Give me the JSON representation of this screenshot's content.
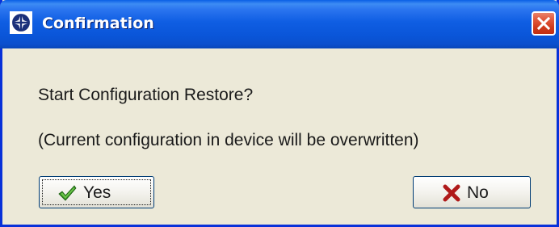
{
  "window": {
    "title": "Confirmation",
    "app_icon": "compass-cross-icon",
    "close_icon": "close-icon",
    "title_bar_color": "#0a55d8",
    "close_button_color": "#e0563a"
  },
  "message": {
    "line1": "Start Configuration Restore?",
    "line2": "(Current configuration in device will be overwritten)"
  },
  "buttons": {
    "yes": {
      "label": "Yes",
      "icon": "checkmark-icon",
      "icon_color": "#2e8b1e",
      "focused": true
    },
    "no": {
      "label": "No",
      "icon": "x-mark-icon",
      "icon_color": "#b01a1a"
    }
  }
}
